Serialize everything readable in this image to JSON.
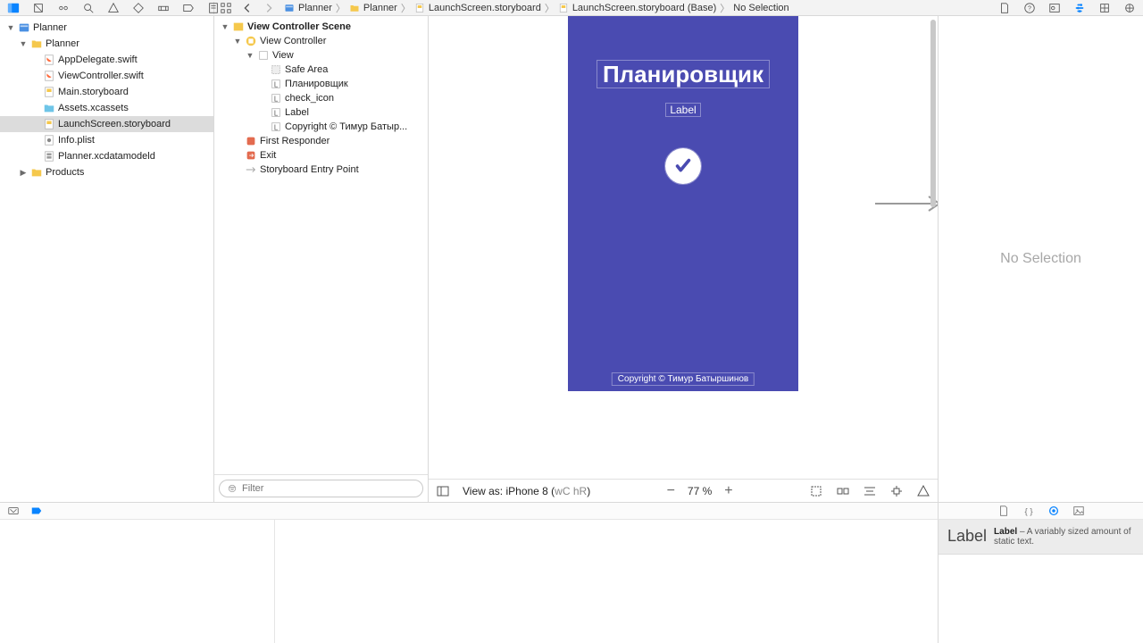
{
  "nav_toolbar": {
    "icons": [
      "folder",
      "source-control",
      "debug",
      "find",
      "issue",
      "test",
      "breakpoint",
      "report",
      "coverage",
      "review"
    ]
  },
  "insp_toolbar": {
    "icons": [
      "file",
      "help",
      "identity",
      "attributes",
      "size",
      "connections"
    ]
  },
  "breadcrumbs": [
    {
      "icon": "project",
      "label": "Planner"
    },
    {
      "icon": "folder",
      "label": "Planner"
    },
    {
      "icon": "storyboard",
      "label": "LaunchScreen.storyboard"
    },
    {
      "icon": "storyboard",
      "label": "LaunchScreen.storyboard (Base)"
    },
    {
      "icon": "none",
      "label": "No Selection"
    }
  ],
  "project_tree": [
    {
      "d": 0,
      "tri": "down",
      "icon": "project",
      "label": "Planner"
    },
    {
      "d": 1,
      "tri": "down",
      "icon": "folder",
      "label": "Planner"
    },
    {
      "d": 2,
      "tri": "",
      "icon": "swift",
      "label": "AppDelegate.swift"
    },
    {
      "d": 2,
      "tri": "",
      "icon": "swift",
      "label": "ViewController.swift"
    },
    {
      "d": 2,
      "tri": "",
      "icon": "storyboard",
      "label": "Main.storyboard"
    },
    {
      "d": 2,
      "tri": "",
      "icon": "assets",
      "label": "Assets.xcassets"
    },
    {
      "d": 2,
      "tri": "",
      "icon": "storyboard",
      "label": "LaunchScreen.storyboard",
      "sel": true
    },
    {
      "d": 2,
      "tri": "",
      "icon": "plist",
      "label": "Info.plist"
    },
    {
      "d": 2,
      "tri": "",
      "icon": "datamodel",
      "label": "Planner.xcdatamodeld"
    },
    {
      "d": 1,
      "tri": "right",
      "icon": "folder",
      "label": "Products"
    }
  ],
  "outline_tree": [
    {
      "d": 0,
      "tri": "down",
      "icon": "scene",
      "label": "View Controller Scene",
      "bold": true
    },
    {
      "d": 1,
      "tri": "down",
      "icon": "vc",
      "label": "View Controller"
    },
    {
      "d": 2,
      "tri": "down",
      "icon": "view",
      "label": "View"
    },
    {
      "d": 3,
      "tri": "",
      "icon": "safe",
      "label": "Safe Area"
    },
    {
      "d": 3,
      "tri": "",
      "icon": "L",
      "label": "Планировщик"
    },
    {
      "d": 3,
      "tri": "",
      "icon": "L",
      "label": "check_icon"
    },
    {
      "d": 3,
      "tri": "",
      "icon": "L",
      "label": "Label"
    },
    {
      "d": 3,
      "tri": "",
      "icon": "L",
      "label": "Copyright © Тимур Батыр..."
    },
    {
      "d": 1,
      "tri": "",
      "icon": "responder",
      "label": "First Responder"
    },
    {
      "d": 1,
      "tri": "",
      "icon": "exit",
      "label": "Exit"
    },
    {
      "d": 1,
      "tri": "",
      "icon": "entry",
      "label": "Storyboard Entry Point"
    }
  ],
  "filter": {
    "placeholder": "Filter"
  },
  "canvas": {
    "title": "Планировщик",
    "subtitle": "Label",
    "copyright": "Copyright © Тимур Батыршинов",
    "view_as": "View as: iPhone 8 (",
    "size_class": "wC hR",
    "view_as_close": ")",
    "zoom": "77 %"
  },
  "inspector": {
    "empty": "No Selection"
  },
  "library": {
    "item_title": "Label",
    "item_name": "Label",
    "item_desc": " – A variably sized amount of static text."
  }
}
